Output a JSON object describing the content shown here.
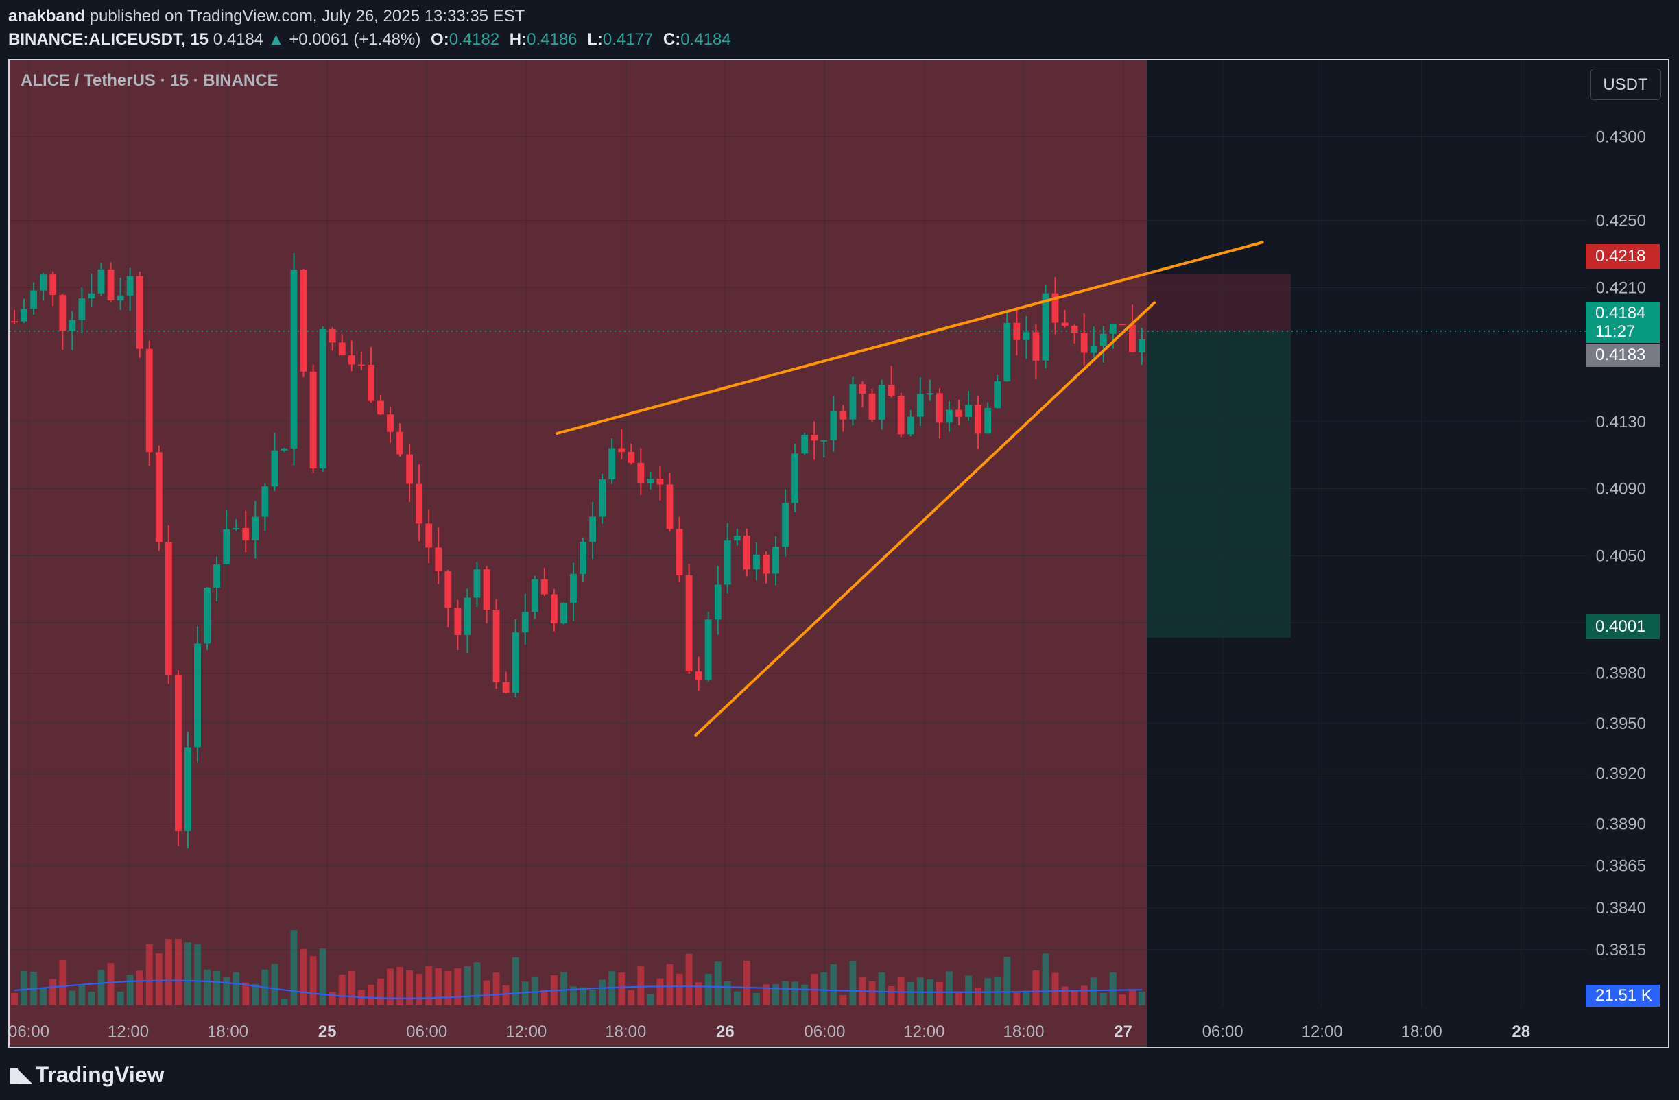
{
  "header": {
    "publisher": "anakband",
    "published_text": "published on TradingView.com, July 26, 2025 13:33:35 EST",
    "symbol_interval": "BINANCE:ALICEUSDT, 15",
    "last": "0.4184",
    "change_arrow": "▲",
    "change": "+0.0061 (+1.48%)",
    "open_label": "O:",
    "open": "0.4182",
    "high_label": "H:",
    "high": "0.4186",
    "low_label": "L:",
    "low": "0.4177",
    "close_label": "C:",
    "close": "0.4184"
  },
  "chart": {
    "title": "ALICE / TetherUS · 15 · BINANCE",
    "currency_button": "USDT"
  },
  "price_tags": {
    "upper_target": "0.4218",
    "last_price": "0.4184",
    "countdown": "11:27",
    "prev_close": "0.4183",
    "lower_target": "0.4001",
    "volume": "21.51 K"
  },
  "footer": {
    "logo_icon": "tradingview-logo-icon",
    "logo_text": "TradingView"
  },
  "colors": {
    "background": "#131722",
    "up": "#089981",
    "down": "#f23645",
    "trendline": "#ff9800",
    "volume_ma": "#2962ff",
    "short_zone_shade": "#5c2b35"
  },
  "chart_data": {
    "type": "candlestick",
    "symbol": "ALICE / TetherUS",
    "exchange": "BINANCE",
    "interval": "15",
    "price_axis": {
      "ticks": [
        "0.4300",
        "0.4250",
        "0.4210",
        "0.4130",
        "0.4090",
        "0.4050",
        "0.4010",
        "0.3980",
        "0.3950",
        "0.3920",
        "0.3890",
        "0.3865",
        "0.3840",
        "0.3815"
      ],
      "range": [
        0.379,
        0.433
      ]
    },
    "time_axis": {
      "ticks": [
        "06:00",
        "12:00",
        "18:00",
        "25",
        "06:00",
        "12:00",
        "18:00",
        "26",
        "06:00",
        "12:00",
        "18:00",
        "27",
        "06:00",
        "12:00",
        "18:00",
        "28"
      ]
    },
    "price_path": [
      [
        0,
        0.419
      ],
      [
        3,
        0.4215
      ],
      [
        5,
        0.419
      ],
      [
        7,
        0.4205
      ],
      [
        9,
        0.422
      ],
      [
        10,
        0.4205
      ],
      [
        12,
        0.4215
      ],
      [
        13,
        0.418
      ],
      [
        14,
        0.412
      ],
      [
        15,
        0.405
      ],
      [
        16,
        0.398
      ],
      [
        17,
        0.389
      ],
      [
        18,
        0.394
      ],
      [
        19,
        0.399
      ],
      [
        20,
        0.403
      ],
      [
        22,
        0.407
      ],
      [
        24,
        0.406
      ],
      [
        26,
        0.41
      ],
      [
        28,
        0.412
      ],
      [
        29,
        0.422
      ],
      [
        30,
        0.416
      ],
      [
        31,
        0.411
      ],
      [
        32,
        0.418
      ],
      [
        34,
        0.417
      ],
      [
        36,
        0.416
      ],
      [
        38,
        0.414
      ],
      [
        40,
        0.411
      ],
      [
        42,
        0.407
      ],
      [
        44,
        0.404
      ],
      [
        46,
        0.4
      ],
      [
        48,
        0.405
      ],
      [
        50,
        0.398
      ],
      [
        51,
        0.396
      ],
      [
        52,
        0.401
      ],
      [
        54,
        0.403
      ],
      [
        56,
        0.401
      ],
      [
        58,
        0.404
      ],
      [
        60,
        0.408
      ],
      [
        62,
        0.411
      ],
      [
        64,
        0.41
      ],
      [
        66,
        0.41
      ],
      [
        68,
        0.407
      ],
      [
        69,
        0.403
      ],
      [
        70,
        0.398
      ],
      [
        71,
        0.397
      ],
      [
        72,
        0.401
      ],
      [
        74,
        0.406
      ],
      [
        76,
        0.405
      ],
      [
        78,
        0.404
      ],
      [
        80,
        0.408
      ],
      [
        81,
        0.412
      ],
      [
        83,
        0.412
      ],
      [
        85,
        0.413
      ],
      [
        87,
        0.415
      ],
      [
        89,
        0.414
      ],
      [
        90,
        0.416
      ],
      [
        92,
        0.413
      ],
      [
        94,
        0.415
      ],
      [
        96,
        0.413
      ],
      [
        98,
        0.414
      ],
      [
        100,
        0.413
      ],
      [
        102,
        0.415
      ],
      [
        103,
        0.419
      ],
      [
        104,
        0.418
      ],
      [
        106,
        0.417
      ],
      [
        107,
        0.42
      ],
      [
        109,
        0.419
      ],
      [
        111,
        0.418
      ],
      [
        113,
        0.418
      ],
      [
        114,
        0.4195
      ],
      [
        116,
        0.4175
      ],
      [
        117,
        0.4184
      ]
    ],
    "trendlines": [
      {
        "name": "upper",
        "from": {
          "x": 56.3,
          "y": 0.4123
        },
        "to": {
          "x": 129.5,
          "y": 0.4237
        }
      },
      {
        "name": "lower",
        "from": {
          "x": 70.7,
          "y": 0.3943
        },
        "to": {
          "x": 118.3,
          "y": 0.4201
        }
      }
    ],
    "position_tool": {
      "entry": 0.4184,
      "stop": 0.4218,
      "target": 0.4001
    }
  }
}
